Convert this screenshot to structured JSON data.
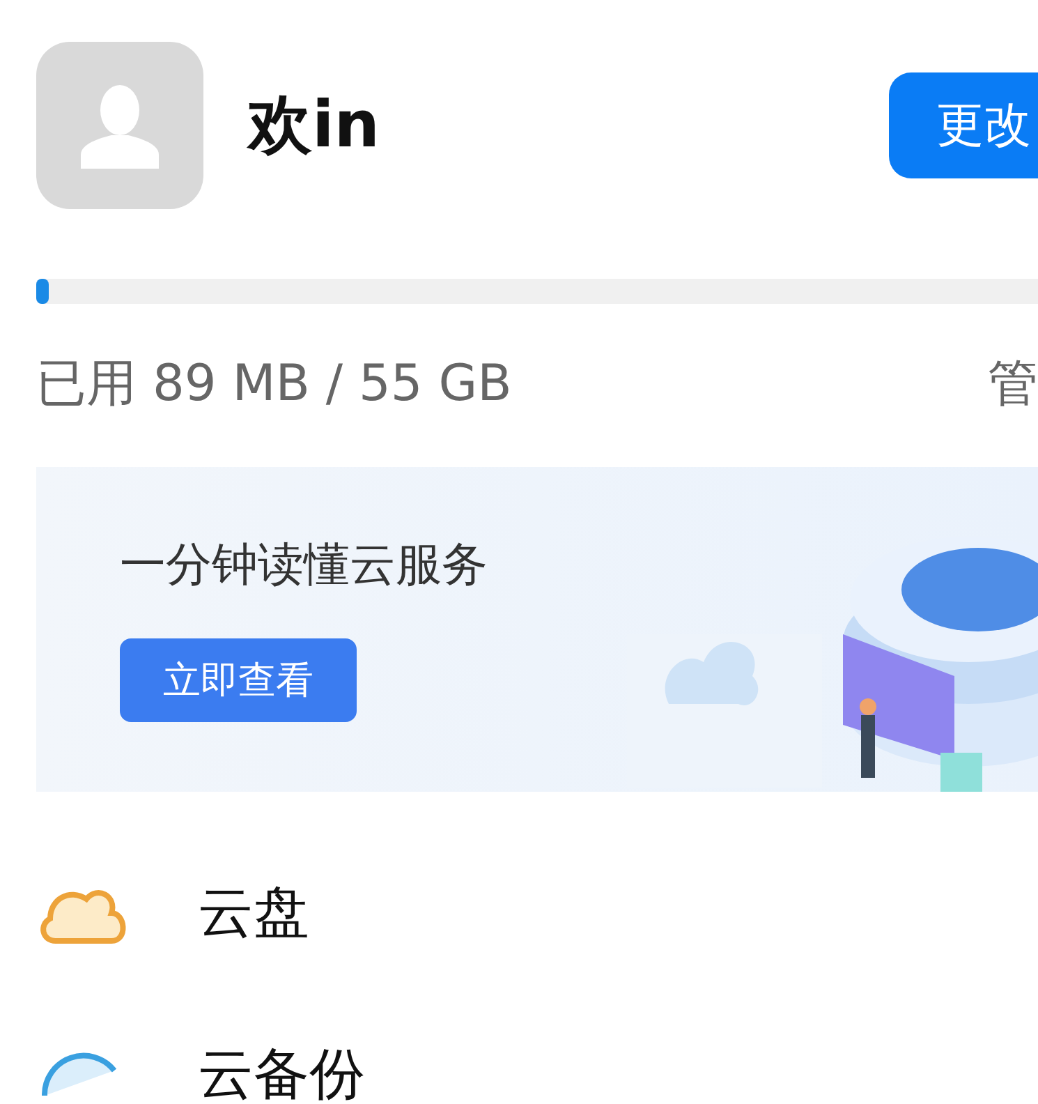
{
  "profile": {
    "greeting": "欢in",
    "change_button": "更改"
  },
  "storage": {
    "level": 0.012,
    "usage": "已用 89 MB / 55 GB",
    "manage_link": "管"
  },
  "banner": {
    "title": "一分钟读懂云服务",
    "button": "立即查看"
  },
  "menu": [
    {
      "kind": "cloud",
      "label": "云盘"
    },
    {
      "kind": "backup",
      "label": "云备份"
    }
  ]
}
